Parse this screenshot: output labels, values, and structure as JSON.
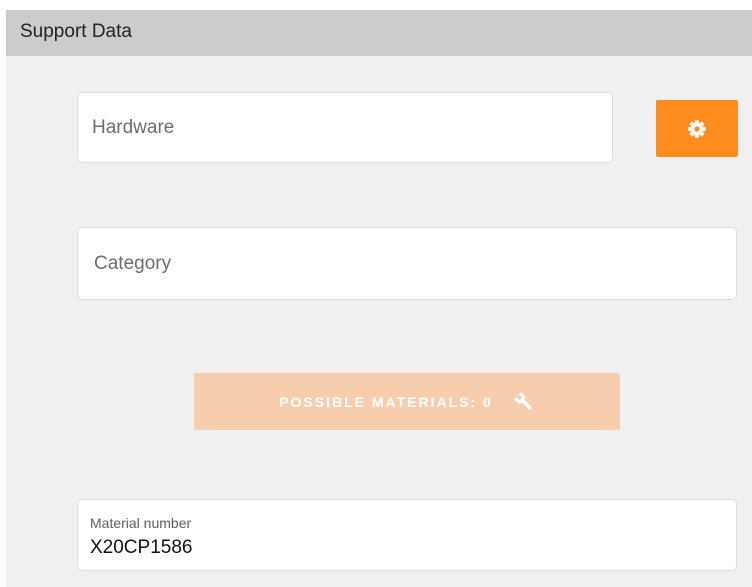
{
  "header": {
    "title": "Support Data"
  },
  "form": {
    "hardware": {
      "placeholder": "Hardware"
    },
    "category": {
      "placeholder": "Category"
    },
    "material": {
      "label": "Material number",
      "value": "X20CP1586"
    }
  },
  "buttons": {
    "settings": {
      "icon": "gear-icon"
    },
    "materials": {
      "label": "POSSIBLE MATERIALS: 0",
      "icon": "wrench-icon"
    }
  },
  "colors": {
    "accent": "#ff8c1e",
    "accent_disabled": "#f6ceae",
    "header_background": "#cccccc",
    "panel_background": "#f0f0f0"
  }
}
